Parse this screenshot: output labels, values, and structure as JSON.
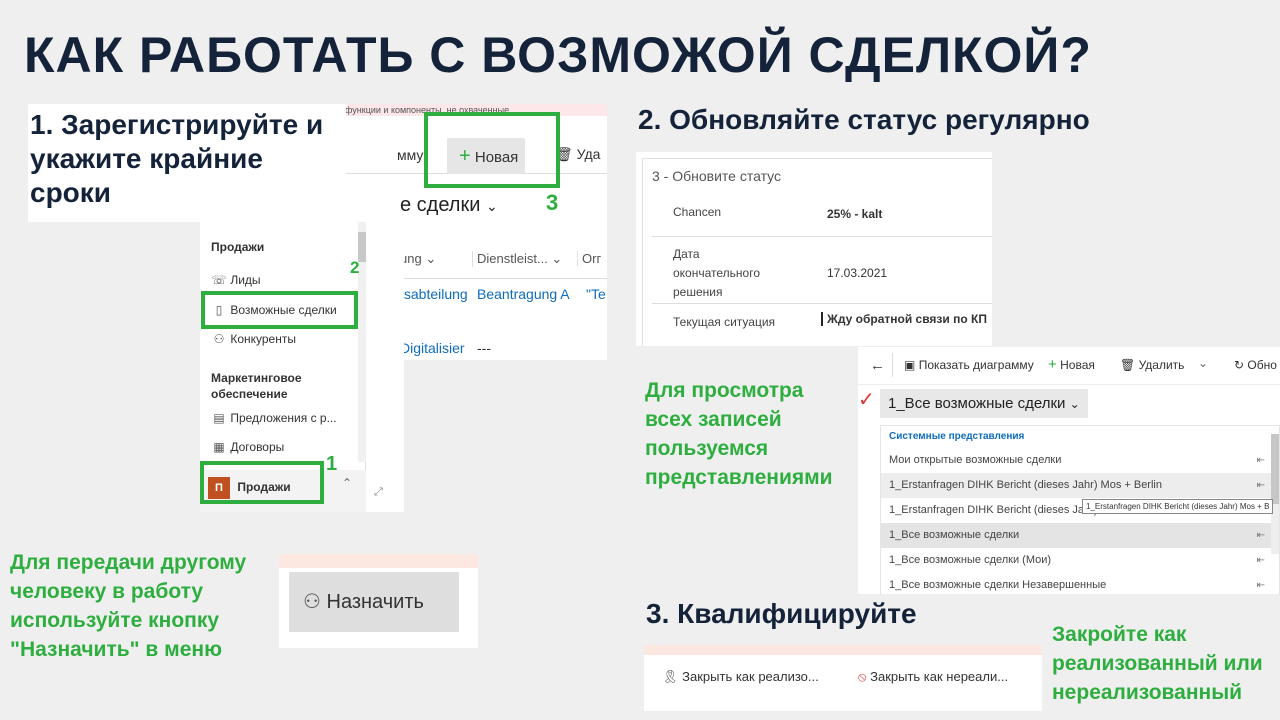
{
  "title": "КАК РАБОТАТЬ С ВОЗМОЖОЙ СДЕЛКОЙ?",
  "step1": {
    "heading": "1. Зарегистрируйте и укажите крайние сроки",
    "sitemap": {
      "group_sales": "Продажи",
      "items": [
        "Лиды",
        "Возможные сделки",
        "Конкуренты"
      ],
      "group_marketing": "Маркетинговое обеспечение",
      "items2": [
        "Предложения с р...",
        "Договоры"
      ],
      "area_badge": "П",
      "area_label": "Продажи"
    },
    "banner_text": "функции и компоненты, не охваченные",
    "toolbar_partial": "мму",
    "new_button": "Новая",
    "delete_partial": "Уда",
    "view_title": "е сделки",
    "columns": [
      "ung",
      "Dienstleist...",
      "Orг"
    ],
    "rows": [
      [
        "tsabteilung",
        "Beantragung A",
        "\"Te"
      ],
      [
        "Digitalisier",
        "---",
        ""
      ]
    ],
    "markers": [
      "1",
      "2",
      "3"
    ]
  },
  "step2": {
    "heading": "2. Обновляйте статус регулярно",
    "card_header": "3 - Обновите статус",
    "fields": [
      {
        "label": "Chancen",
        "value": "25% - kalt"
      },
      {
        "label": "Дата окончательного решения",
        "value": "17.03.2021"
      },
      {
        "label": "Текущая ситуация",
        "value": "Жду обратной связи по КП"
      }
    ]
  },
  "views": {
    "note": "Для просмотра всех записей пользуемся представлениями",
    "toolbar": [
      "Показать диаграмму",
      "Новая",
      "Удалить",
      "Обно"
    ],
    "selector": "1_Все возможные сделки",
    "section_label": "Системные представления",
    "items": [
      "Мои открытые возможные сделки",
      "1_Erstanfragen DIHK Bericht (dieses Jahr) Mos + Berlin",
      "1_Erstanfragen DIHK Bericht (dieses Jahr)",
      "1_Все возможные сделки",
      "1_Все возможные сделки (Мои)",
      "1_Все возможные сделки Незавершенные"
    ],
    "tooltip": "1_Erstanfragen DIHK Bericht (dieses Jahr) Mos + B"
  },
  "assign": {
    "note": "Для передачи другому человеку в работу используйте кнопку \"Назначить\" в меню",
    "button": "Назначить"
  },
  "step3": {
    "heading": "3. Квалифицируйте",
    "buttons": [
      "Закрыть как реализо...",
      "Закрыть как нереали..."
    ],
    "note": "Закройте как реализованный или нереализованный"
  },
  "colors": {
    "accent": "#2eae3f",
    "title": "#14233a",
    "crm_link": "#0f6cbd",
    "area_badge": "#c0501f"
  }
}
